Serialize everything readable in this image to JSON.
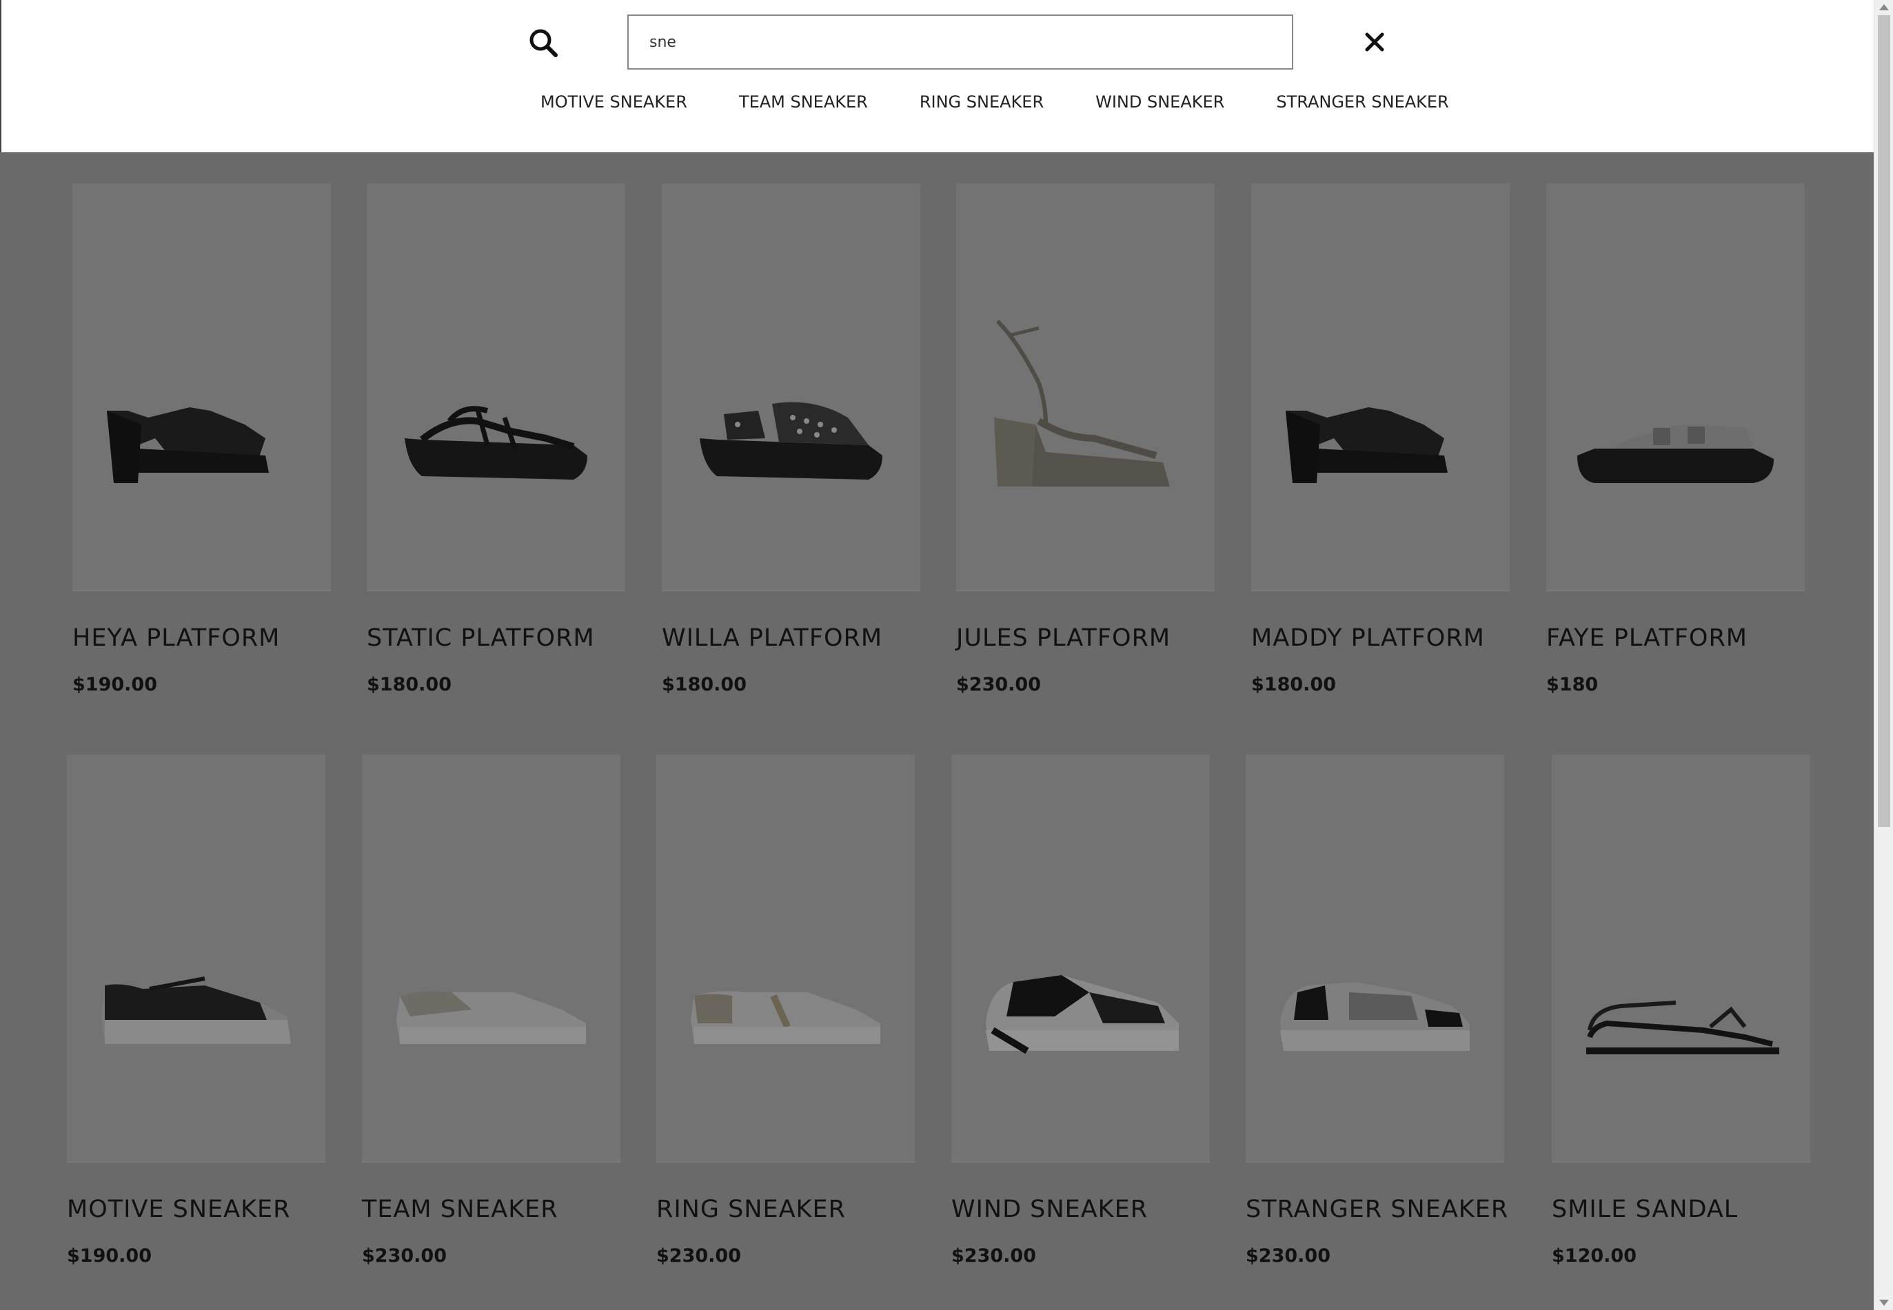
{
  "search": {
    "value": "sne",
    "suggestions": [
      "MOTIVE SNEAKER",
      "TEAM SNEAKER",
      "RING SNEAKER",
      "WIND SNEAKER",
      "STRANGER SNEAKER"
    ]
  },
  "products": [
    {
      "name": "HEYA PLATFORM",
      "price": "$190.00",
      "icon": "platform-mule-shoe"
    },
    {
      "name": "STATIC PLATFORM",
      "price": "$180.00",
      "icon": "platform-strap-sandal"
    },
    {
      "name": "WILLA PLATFORM",
      "price": "$180.00",
      "icon": "studded-platform-sandal"
    },
    {
      "name": "JULES PLATFORM",
      "price": "$230.00",
      "icon": "metallic-lace-up-platform"
    },
    {
      "name": "MADDY PLATFORM",
      "price": "$180.00",
      "icon": "platform-mule-shoe"
    },
    {
      "name": "FAYE PLATFORM",
      "price": "$180",
      "icon": "buckle-slide-sandal"
    },
    {
      "name": "MOTIVE SNEAKER",
      "price": "$190.00",
      "icon": "black-white-sneaker"
    },
    {
      "name": "TEAM SNEAKER",
      "price": "$230.00",
      "icon": "white-sneaker"
    },
    {
      "name": "RING SNEAKER",
      "price": "$230.00",
      "icon": "white-gold-sneaker"
    },
    {
      "name": "WIND SNEAKER",
      "price": "$230.00",
      "icon": "chunky-black-white-sneaker"
    },
    {
      "name": "STRANGER SNEAKER",
      "price": "$230.00",
      "icon": "chunky-grey-sneaker"
    },
    {
      "name": "SMILE SANDAL",
      "price": "$120.00",
      "icon": "flat-strappy-sandal"
    }
  ],
  "colors": {
    "overlay": "#6a6a6a",
    "card_bg": "#737373",
    "text": "#111111"
  }
}
